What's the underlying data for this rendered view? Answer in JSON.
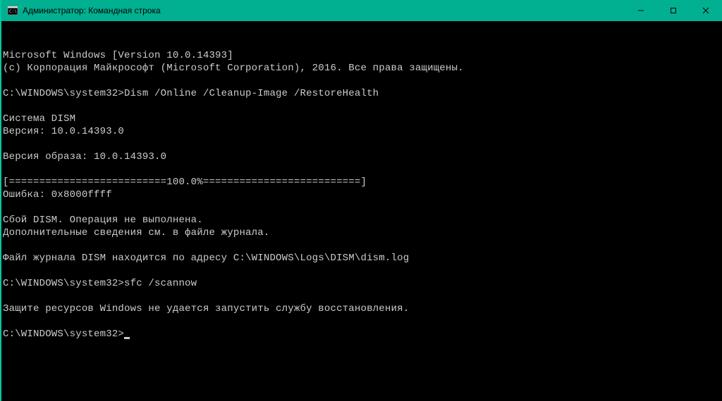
{
  "titlebar": {
    "title": "Администратор: Командная строка"
  },
  "terminal": {
    "lines": [
      "Microsoft Windows [Version 10.0.14393]",
      "(c) Корпорация Майкрософт (Microsoft Corporation), 2016. Все права защищены.",
      "",
      "C:\\WINDOWS\\system32>Dism /Online /Cleanup-Image /RestoreHealth",
      "",
      "Cистема DISM",
      "Версия: 10.0.14393.0",
      "",
      "Версия образа: 10.0.14393.0",
      "",
      "[==========================100.0%==========================]",
      "Ошибка: 0x8000ffff",
      "",
      "Сбой DISM. Операция не выполнена.",
      "Дополнительные сведения см. в файле журнала.",
      "",
      "Файл журнала DISM находится по адресу C:\\WINDOWS\\Logs\\DISM\\dism.log",
      "",
      "C:\\WINDOWS\\system32>sfc /scannow",
      "",
      "Защите ресурсов Windows не удается запустить службу восстановления.",
      "",
      "C:\\WINDOWS\\system32>"
    ]
  }
}
